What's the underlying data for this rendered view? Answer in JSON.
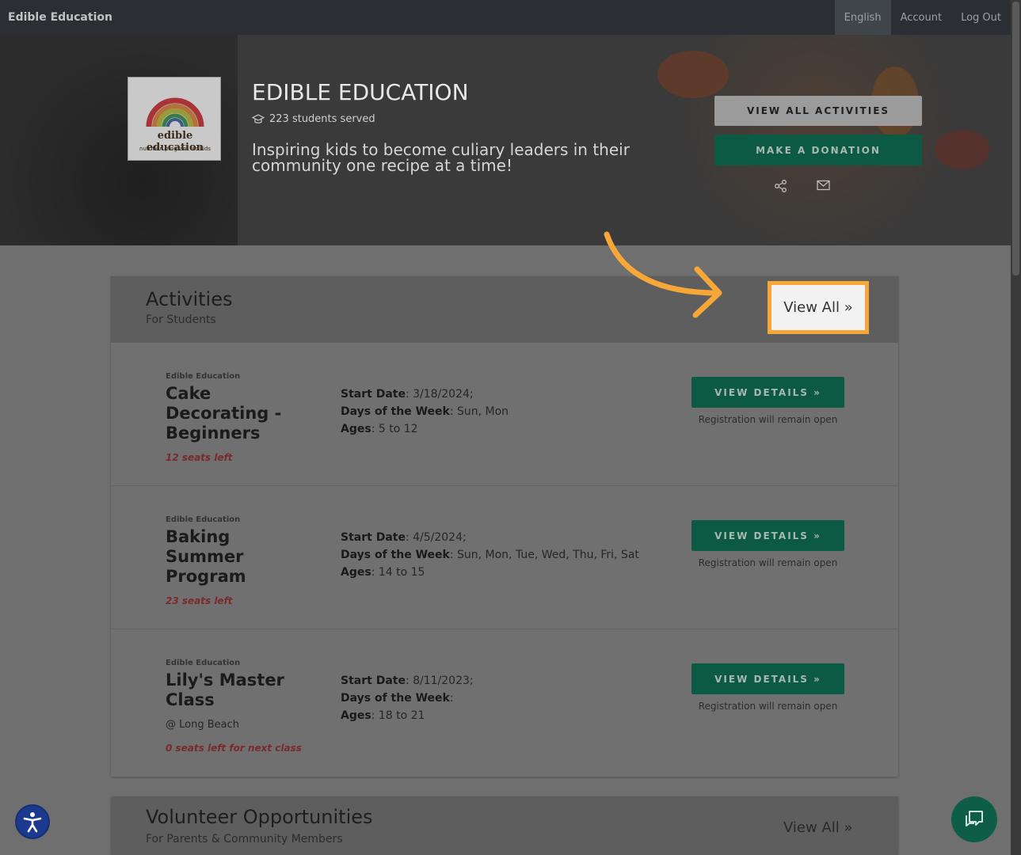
{
  "nav": {
    "brand": "Edible Education",
    "links": [
      "English",
      "Account",
      "Log Out"
    ]
  },
  "hero": {
    "logo_text": "edible education",
    "logo_subtext": "nutrition program for kids",
    "title": "EDIBLE EDUCATION",
    "students_served": "223 students served",
    "tagline": "Inspiring kids to become culiary leaders in their community one recipe at a time!",
    "btn_view_all_activities": "VIEW ALL ACTIVITIES",
    "btn_make_donation": "MAKE A DONATION"
  },
  "activities": {
    "title": "Activities",
    "subtitle": "For Students",
    "view_all": "View All »",
    "items": [
      {
        "org": "Edible Education",
        "title": "Cake Decorating - Beginners",
        "seats": "12 seats left",
        "location": "",
        "start_label": "Start Date",
        "start_value": ": 3/18/2024;",
        "days_label": "Days of the Week",
        "days_value": ": Sun, Mon",
        "ages_label": "Ages",
        "ages_value": ": 5 to 12",
        "button": "VIEW DETAILS »",
        "registration": "Registration will remain open"
      },
      {
        "org": "Edible Education",
        "title": "Baking Summer Program",
        "seats": "23 seats left",
        "location": "",
        "start_label": "Start Date",
        "start_value": ": 4/5/2024;",
        "days_label": "Days of the Week",
        "days_value": ": Sun, Mon, Tue, Wed, Thu, Fri, Sat",
        "ages_label": "Ages",
        "ages_value": ": 14 to 15",
        "button": "VIEW DETAILS »",
        "registration": "Registration will remain open"
      },
      {
        "org": "Edible Education",
        "title": "Lily's Master Class",
        "seats": "0 seats left for next class",
        "location": "@ Long Beach",
        "start_label": "Start Date",
        "start_value": ": 8/11/2023;",
        "days_label": "Days of the Week",
        "days_value": ":",
        "ages_label": "Ages",
        "ages_value": ": 18 to 21",
        "button": "VIEW DETAILS »",
        "registration": "Registration will remain open"
      }
    ]
  },
  "volunteer": {
    "title": "Volunteer Opportunities",
    "subtitle": "For Parents & Community Members",
    "view_all": "View All »"
  },
  "annotation": {
    "highlight_label": "View All »",
    "highlight_color": "#f7a738"
  },
  "colors": {
    "primary_green": "#0d5a44",
    "seats_red": "#7a2a2a",
    "nav_bg": "#2b2f33"
  },
  "icons": {
    "share": "share-icon",
    "mail": "mail-icon",
    "graduation": "graduation-cap-icon",
    "accessibility": "accessibility-icon",
    "chat": "chat-icon"
  }
}
